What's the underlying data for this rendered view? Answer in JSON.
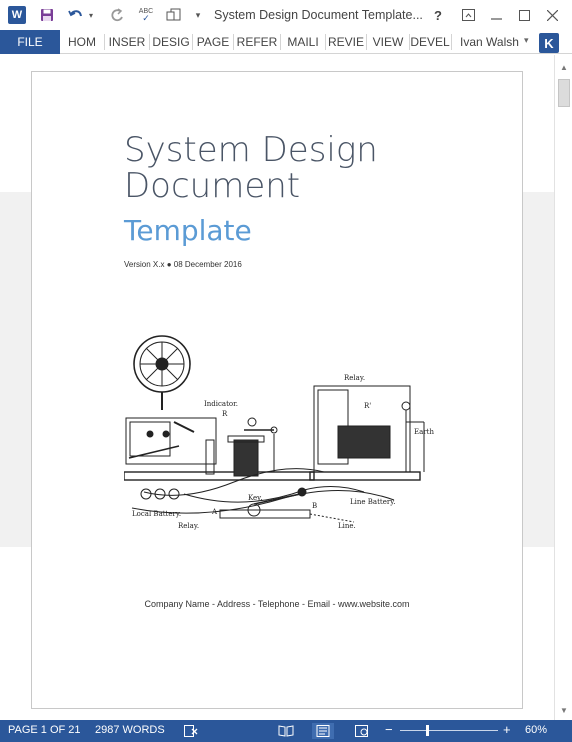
{
  "titlebar": {
    "app_icon_letter": "W",
    "app_icon": "word-logo-icon",
    "title": "System Design Document Template...",
    "quick_access": [
      "save-icon",
      "undo-icon",
      "redo-icon",
      "spelling-icon",
      "new-doc-icon",
      "customize-icon"
    ],
    "spelling_label": "ABC",
    "help_label": "?",
    "buttons": [
      "ribbon-options-icon",
      "minimize-icon",
      "maximize-icon",
      "close-icon"
    ]
  },
  "ribbon": {
    "file_label": "FILE",
    "tabs": [
      "HOM",
      "INSER",
      "DESIG",
      "PAGE",
      "REFER",
      "MAILI",
      "REVIE",
      "VIEW",
      "DEVEL"
    ],
    "user_name": "Ivan Walsh",
    "user_initial": "K"
  },
  "document": {
    "title_line1": "System Design",
    "title_line2": "Document",
    "subtitle": "Template",
    "version": "Version X.x ● 08 December 2016",
    "footer": "Company Name - Address - Telephone - Email - www.website.com",
    "illustration_labels": {
      "indicator": "Indicator.",
      "indicator_r": "R",
      "relay_top": "Relay.",
      "relay_r": "R'",
      "earth": "Earth",
      "local_battery": "Local Battery.",
      "key": "Key.",
      "a": "A",
      "b": "B",
      "line_battery": "Line Battery.",
      "relay_bottom": "Relay.",
      "line": "Line."
    }
  },
  "statusbar": {
    "page": "PAGE 1 OF 21",
    "words": "2987 WORDS",
    "zoom_minus": "−",
    "zoom_plus": "+",
    "zoom": "60%",
    "zoom_level": 0.6,
    "views": [
      "read-mode-icon",
      "print-layout-icon",
      "web-layout-icon"
    ]
  },
  "colors": {
    "accent": "#2b579a",
    "title_text": "#4a5566",
    "subtitle_text": "#5b9bd5"
  }
}
